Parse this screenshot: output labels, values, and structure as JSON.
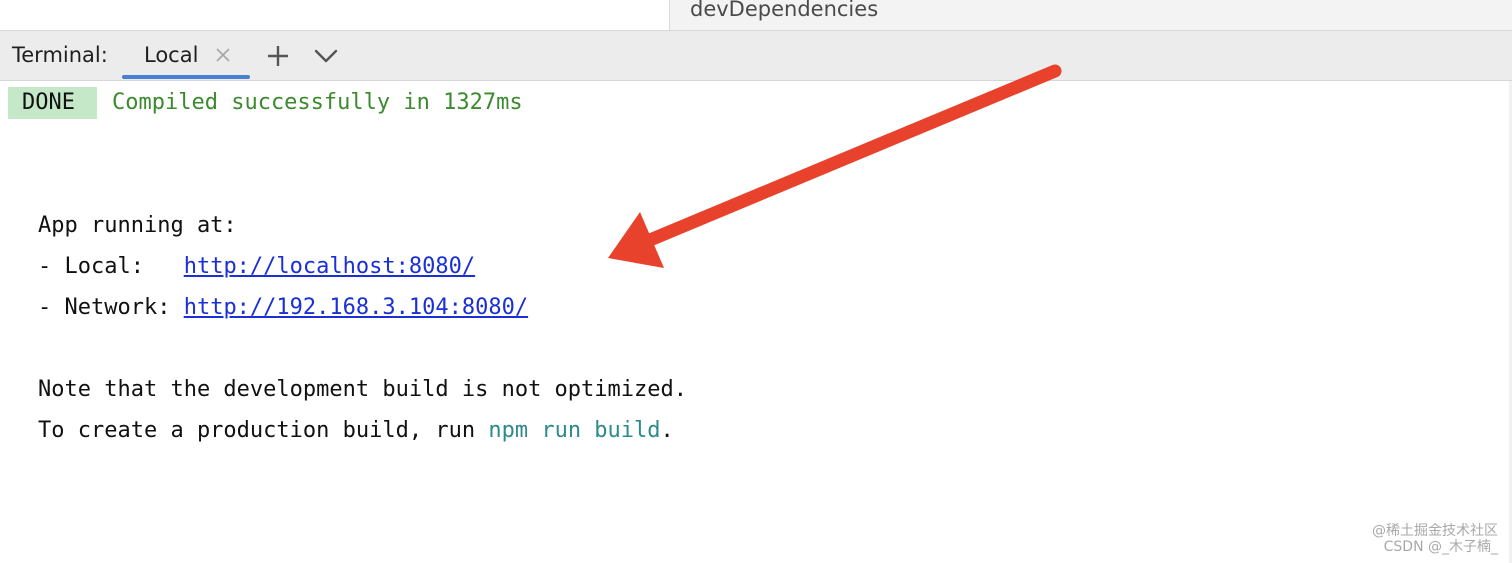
{
  "editor_tab": {
    "label": "devDependencies"
  },
  "terminal": {
    "title": "Terminal:",
    "tabs": [
      {
        "label": "Local",
        "active": true
      }
    ],
    "add_icon": "plus-icon",
    "menu_icon": "chevron-down-icon",
    "close_icon": "close-icon"
  },
  "output": {
    "badge": "DONE",
    "compiled_message": "Compiled successfully in 1327ms",
    "app_running": "App running at:",
    "local_prefix": "- Local:   ",
    "local_url": "http://localhost:8080/",
    "network_prefix": "- Network: ",
    "network_url": "http://192.168.3.104:8080/",
    "note_line": "Note that the development build is not optimized.",
    "create_prefix": "To create a production build, run ",
    "create_cmd": "npm run build",
    "create_suffix": "."
  },
  "watermark": {
    "line1": "@稀土掘金技术社区",
    "line2": "CSDN @_木子楠_"
  },
  "colors": {
    "success_green": "#3c8a2e",
    "done_badge_bg": "#c5e8c8",
    "link_blue": "#1a2fd6",
    "command_teal": "#2e8b8b",
    "tab_underline": "#4a7fd3",
    "annotation_arrow": "#e8412c"
  }
}
